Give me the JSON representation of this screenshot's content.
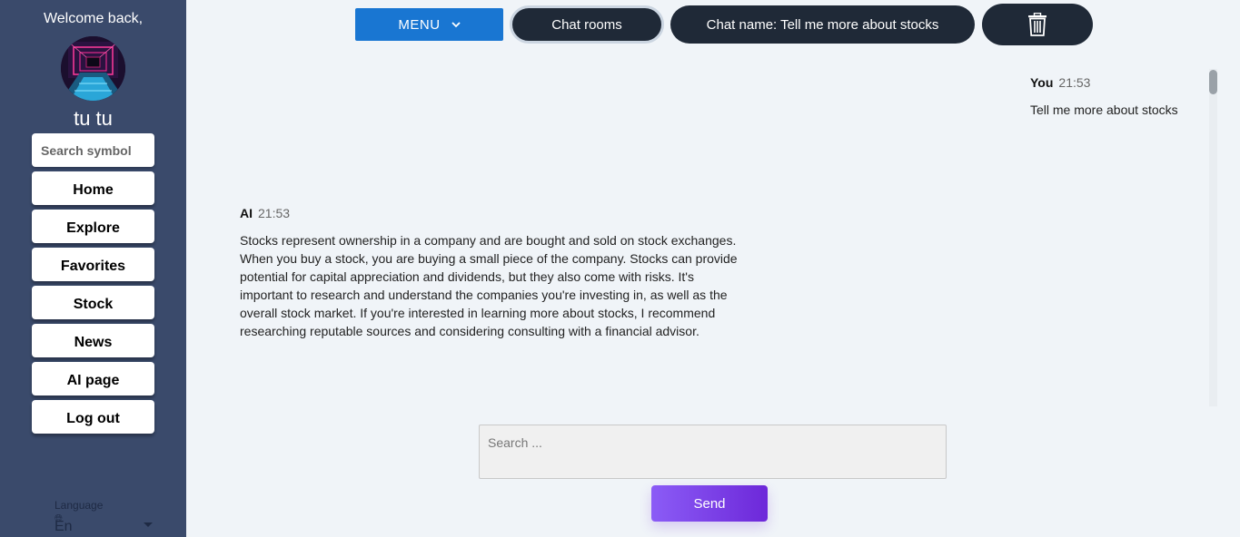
{
  "sidebar": {
    "welcome": "Welcome back,",
    "username": "tu tu",
    "search_placeholder": "Search symbol",
    "nav": [
      "Home",
      "Explore",
      "Favorites",
      "Stock",
      "News",
      "AI page",
      "Log out"
    ],
    "language_label": "Language",
    "language_value": "En"
  },
  "topbar": {
    "menu_label": "MENU",
    "chat_rooms_label": "Chat rooms",
    "chat_name_label": "Chat name: Tell me more about stocks"
  },
  "messages": [
    {
      "sender": "You",
      "time": "21:53",
      "text": "Tell me more about stocks"
    },
    {
      "sender": "AI",
      "time": "21:53",
      "text": "Stocks represent ownership in a company and are bought and sold on stock exchanges. When you buy a stock, you are buying a small piece of the company. Stocks can provide potential for capital appreciation and dividends, but they also come with risks. It's important to research and understand the companies you're investing in, as well as the overall stock market. If you're interested in learning more about stocks, I recommend researching reputable sources and considering consulting with a financial advisor."
    }
  ],
  "composer": {
    "placeholder": "Search ...",
    "send_label": "Send"
  },
  "colors": {
    "sidebar_bg": "#3a4a6b",
    "menu_blue": "#1976d2",
    "pill_dark": "#1f2937",
    "send_gradient_start": "#8b5cf6",
    "send_gradient_end": "#6d28d9"
  }
}
